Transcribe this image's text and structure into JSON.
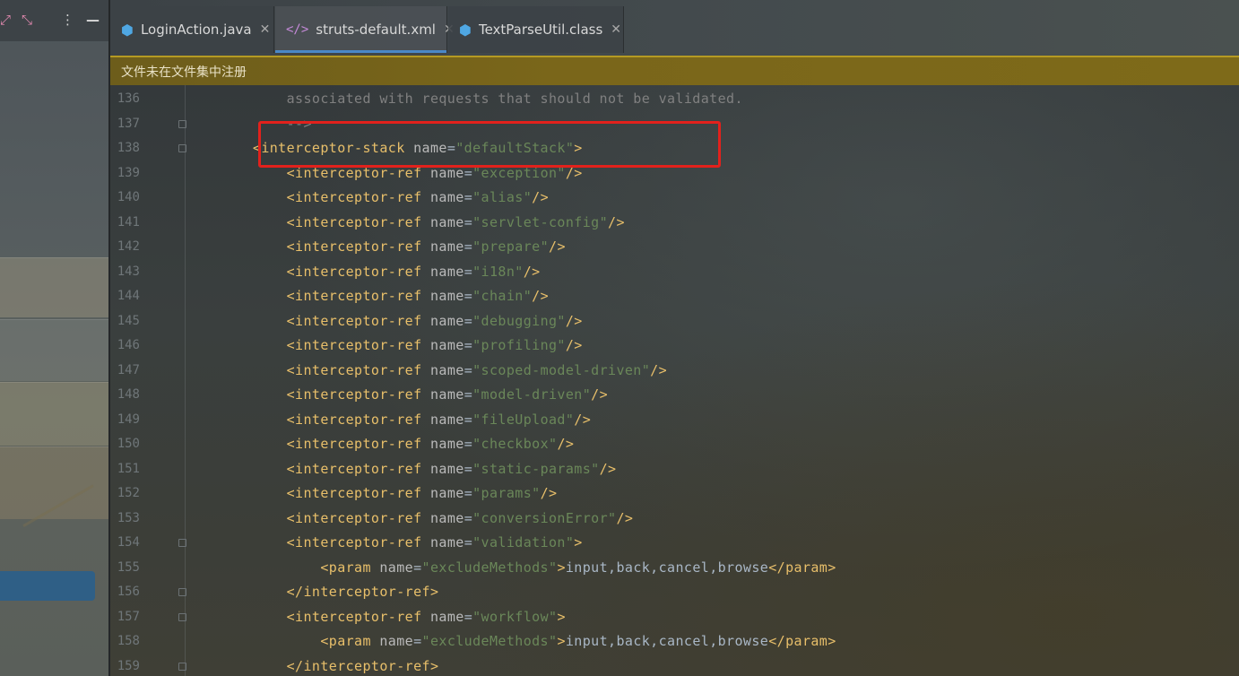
{
  "left_panel": {
    "toolbar_icons": [
      "expand-icon",
      "collapse-icon",
      "more-options-icon",
      "minimize-icon"
    ]
  },
  "tabs": [
    {
      "label": "LoginAction.java",
      "icon": "java-class-icon",
      "active": false
    },
    {
      "label": "struts-default.xml",
      "icon": "xml-file-icon",
      "active": true
    },
    {
      "label": "TextParseUtil.class",
      "icon": "class-file-icon",
      "active": false
    }
  ],
  "banner": {
    "text": "文件未在文件集中注册"
  },
  "editor": {
    "lines": [
      {
        "number": "136",
        "tokens": [
          {
            "t": "                    associated with requests that should not be validated.",
            "c": "cmt"
          }
        ]
      },
      {
        "number": "137",
        "fold": true,
        "tokens": [
          {
            "t": "                    -->",
            "c": "cmt"
          }
        ]
      },
      {
        "number": "138",
        "fold": true,
        "tokens": [
          {
            "t": "                <interceptor-stack ",
            "c": "tag"
          },
          {
            "t": "name",
            "c": "attr"
          },
          {
            "t": "=",
            "c": "txt"
          },
          {
            "t": "\"defaultStack\"",
            "c": "val"
          },
          {
            "t": ">",
            "c": "tag"
          }
        ]
      },
      {
        "number": "139",
        "tokens": [
          {
            "t": "                    <interceptor-ref ",
            "c": "tag"
          },
          {
            "t": "name",
            "c": "attr"
          },
          {
            "t": "=",
            "c": "txt"
          },
          {
            "t": "\"exception\"",
            "c": "val"
          },
          {
            "t": "/>",
            "c": "tag"
          }
        ]
      },
      {
        "number": "140",
        "tokens": [
          {
            "t": "                    <interceptor-ref ",
            "c": "tag"
          },
          {
            "t": "name",
            "c": "attr"
          },
          {
            "t": "=",
            "c": "txt"
          },
          {
            "t": "\"alias\"",
            "c": "val"
          },
          {
            "t": "/>",
            "c": "tag"
          }
        ]
      },
      {
        "number": "141",
        "tokens": [
          {
            "t": "                    <interceptor-ref ",
            "c": "tag"
          },
          {
            "t": "name",
            "c": "attr"
          },
          {
            "t": "=",
            "c": "txt"
          },
          {
            "t": "\"servlet-config\"",
            "c": "val"
          },
          {
            "t": "/>",
            "c": "tag"
          }
        ]
      },
      {
        "number": "142",
        "tokens": [
          {
            "t": "                    <interceptor-ref ",
            "c": "tag"
          },
          {
            "t": "name",
            "c": "attr"
          },
          {
            "t": "=",
            "c": "txt"
          },
          {
            "t": "\"prepare\"",
            "c": "val"
          },
          {
            "t": "/>",
            "c": "tag"
          }
        ]
      },
      {
        "number": "143",
        "tokens": [
          {
            "t": "                    <interceptor-ref ",
            "c": "tag"
          },
          {
            "t": "name",
            "c": "attr"
          },
          {
            "t": "=",
            "c": "txt"
          },
          {
            "t": "\"i18n\"",
            "c": "val"
          },
          {
            "t": "/>",
            "c": "tag"
          }
        ]
      },
      {
        "number": "144",
        "tokens": [
          {
            "t": "                    <interceptor-ref ",
            "c": "tag"
          },
          {
            "t": "name",
            "c": "attr"
          },
          {
            "t": "=",
            "c": "txt"
          },
          {
            "t": "\"chain\"",
            "c": "val"
          },
          {
            "t": "/>",
            "c": "tag"
          }
        ]
      },
      {
        "number": "145",
        "tokens": [
          {
            "t": "                    <interceptor-ref ",
            "c": "tag"
          },
          {
            "t": "name",
            "c": "attr"
          },
          {
            "t": "=",
            "c": "txt"
          },
          {
            "t": "\"debugging\"",
            "c": "val"
          },
          {
            "t": "/>",
            "c": "tag"
          }
        ]
      },
      {
        "number": "146",
        "tokens": [
          {
            "t": "                    <interceptor-ref ",
            "c": "tag"
          },
          {
            "t": "name",
            "c": "attr"
          },
          {
            "t": "=",
            "c": "txt"
          },
          {
            "t": "\"profiling\"",
            "c": "val"
          },
          {
            "t": "/>",
            "c": "tag"
          }
        ]
      },
      {
        "number": "147",
        "tokens": [
          {
            "t": "                    <interceptor-ref ",
            "c": "tag"
          },
          {
            "t": "name",
            "c": "attr"
          },
          {
            "t": "=",
            "c": "txt"
          },
          {
            "t": "\"scoped-model-driven\"",
            "c": "val"
          },
          {
            "t": "/>",
            "c": "tag"
          }
        ]
      },
      {
        "number": "148",
        "tokens": [
          {
            "t": "                    <interceptor-ref ",
            "c": "tag"
          },
          {
            "t": "name",
            "c": "attr"
          },
          {
            "t": "=",
            "c": "txt"
          },
          {
            "t": "\"model-driven\"",
            "c": "val"
          },
          {
            "t": "/>",
            "c": "tag"
          }
        ]
      },
      {
        "number": "149",
        "tokens": [
          {
            "t": "                    <interceptor-ref ",
            "c": "tag"
          },
          {
            "t": "name",
            "c": "attr"
          },
          {
            "t": "=",
            "c": "txt"
          },
          {
            "t": "\"fileUpload\"",
            "c": "val"
          },
          {
            "t": "/>",
            "c": "tag"
          }
        ]
      },
      {
        "number": "150",
        "tokens": [
          {
            "t": "                    <interceptor-ref ",
            "c": "tag"
          },
          {
            "t": "name",
            "c": "attr"
          },
          {
            "t": "=",
            "c": "txt"
          },
          {
            "t": "\"checkbox\"",
            "c": "val"
          },
          {
            "t": "/>",
            "c": "tag"
          }
        ]
      },
      {
        "number": "151",
        "tokens": [
          {
            "t": "                    <interceptor-ref ",
            "c": "tag"
          },
          {
            "t": "name",
            "c": "attr"
          },
          {
            "t": "=",
            "c": "txt"
          },
          {
            "t": "\"static-params\"",
            "c": "val"
          },
          {
            "t": "/>",
            "c": "tag"
          }
        ]
      },
      {
        "number": "152",
        "tokens": [
          {
            "t": "                    <interceptor-ref ",
            "c": "tag"
          },
          {
            "t": "name",
            "c": "attr"
          },
          {
            "t": "=",
            "c": "txt"
          },
          {
            "t": "\"params\"",
            "c": "val"
          },
          {
            "t": "/>",
            "c": "tag"
          }
        ]
      },
      {
        "number": "153",
        "tokens": [
          {
            "t": "                    <interceptor-ref ",
            "c": "tag"
          },
          {
            "t": "name",
            "c": "attr"
          },
          {
            "t": "=",
            "c": "txt"
          },
          {
            "t": "\"conversionError\"",
            "c": "val"
          },
          {
            "t": "/>",
            "c": "tag"
          }
        ]
      },
      {
        "number": "154",
        "fold": true,
        "tokens": [
          {
            "t": "                    <interceptor-ref ",
            "c": "tag"
          },
          {
            "t": "name",
            "c": "attr"
          },
          {
            "t": "=",
            "c": "txt"
          },
          {
            "t": "\"validation\"",
            "c": "val"
          },
          {
            "t": ">",
            "c": "tag"
          }
        ]
      },
      {
        "number": "155",
        "tokens": [
          {
            "t": "                        <param ",
            "c": "tag"
          },
          {
            "t": "name",
            "c": "attr"
          },
          {
            "t": "=",
            "c": "txt"
          },
          {
            "t": "\"excludeMethods\"",
            "c": "val"
          },
          {
            "t": ">",
            "c": "tag"
          },
          {
            "t": "input,back,cancel,browse",
            "c": "txt"
          },
          {
            "t": "</param>",
            "c": "tag"
          }
        ]
      },
      {
        "number": "156",
        "fold": true,
        "tokens": [
          {
            "t": "                    </interceptor-ref>",
            "c": "tag"
          }
        ]
      },
      {
        "number": "157",
        "fold": true,
        "tokens": [
          {
            "t": "                    <interceptor-ref ",
            "c": "tag"
          },
          {
            "t": "name",
            "c": "attr"
          },
          {
            "t": "=",
            "c": "txt"
          },
          {
            "t": "\"workflow\"",
            "c": "val"
          },
          {
            "t": ">",
            "c": "tag"
          }
        ]
      },
      {
        "number": "158",
        "tokens": [
          {
            "t": "                        <param ",
            "c": "tag"
          },
          {
            "t": "name",
            "c": "attr"
          },
          {
            "t": "=",
            "c": "txt"
          },
          {
            "t": "\"excludeMethods\"",
            "c": "val"
          },
          {
            "t": ">",
            "c": "tag"
          },
          {
            "t": "input,back,cancel,browse",
            "c": "txt"
          },
          {
            "t": "</param>",
            "c": "tag"
          }
        ]
      },
      {
        "number": "159",
        "fold": true,
        "tokens": [
          {
            "t": "                    </interceptor-ref>",
            "c": "tag"
          }
        ]
      }
    ]
  },
  "colors": {
    "accent": "#4a88c7",
    "highlight_box": "#e2211c",
    "xml_tag": "#e8bf6a",
    "xml_value": "#6a8759",
    "banner": "#7a661a"
  }
}
